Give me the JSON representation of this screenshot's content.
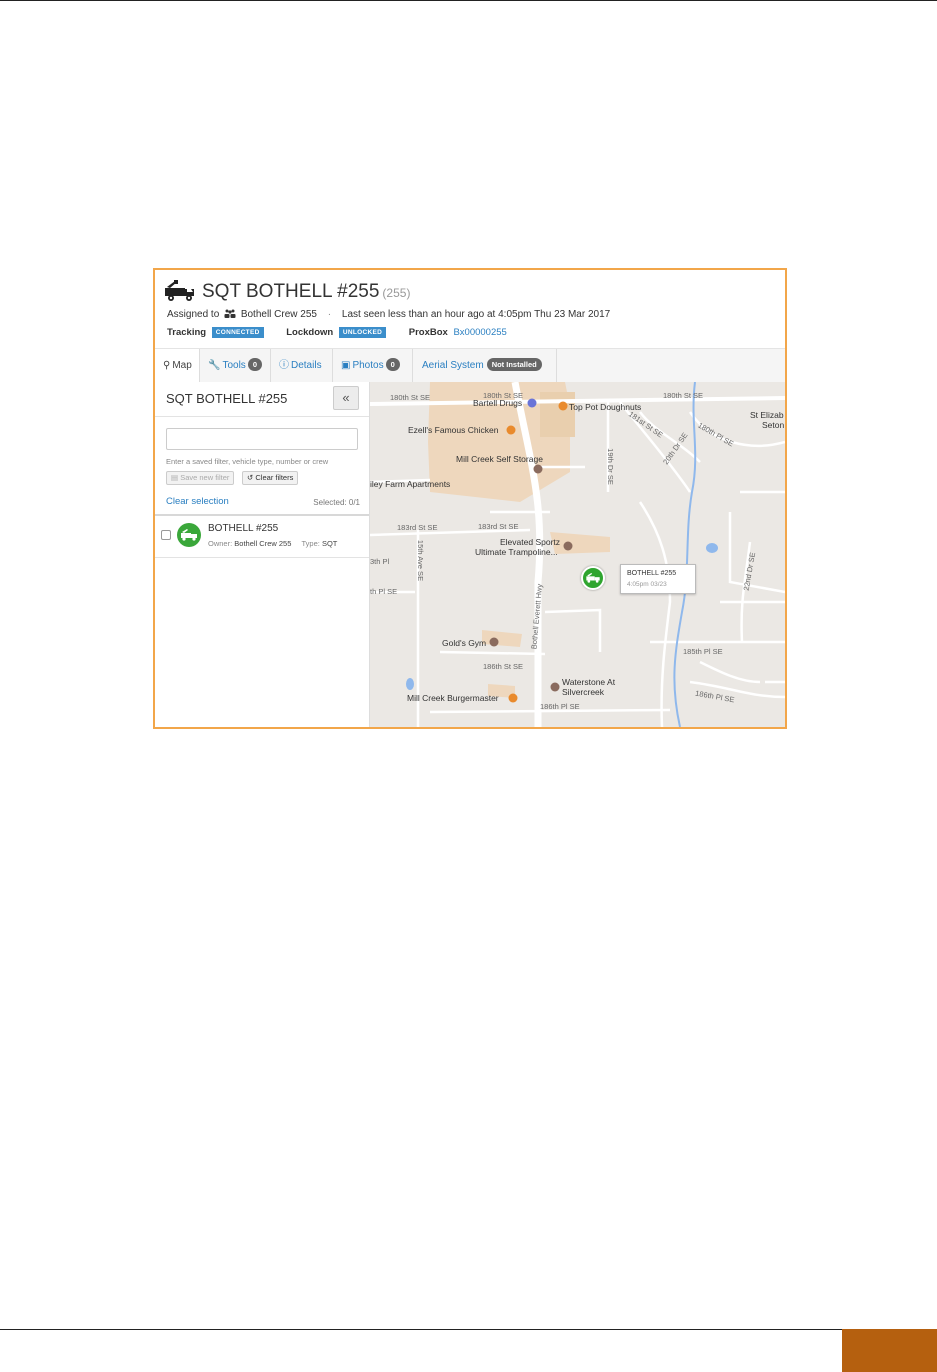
{
  "header": {
    "title": "SQT BOTHELL #255",
    "vehicle_number": "(255)",
    "assigned_label": "Assigned to",
    "crew_name": "Bothell Crew 255",
    "separator": "·",
    "last_seen": "Last seen less than an hour ago at 4:05pm Thu 23 Mar 2017",
    "tracking_label": "Tracking",
    "tracking_status": "CONNECTED",
    "lockdown_label": "Lockdown",
    "lockdown_status": "UNLOCKED",
    "proxbox_label": "ProxBox",
    "proxbox_id": "Bx00000255",
    "status_color": "#3b8ecb"
  },
  "tabs": [
    {
      "label": "Map",
      "icon": "map-marker-icon",
      "active": true
    },
    {
      "label": "Tools",
      "icon": "wrench-icon",
      "count": "0"
    },
    {
      "label": "Details",
      "icon": "info-icon"
    },
    {
      "label": "Photos",
      "icon": "image-icon",
      "count": "0"
    },
    {
      "label": "Aerial System",
      "badge": "Not Installed"
    }
  ],
  "sidebar": {
    "title": "SQT BOTHELL #255",
    "collapse_glyph": "«",
    "filter_value": "",
    "filter_help": "Enter a saved filter, vehicle type, number or crew",
    "save_filter_label": "Save new filter",
    "clear_filters_label": "Clear filters",
    "clear_selection_label": "Clear selection",
    "selected_count": "Selected: 0/1",
    "vehicles": [
      {
        "name": "BOTHELL #255",
        "owner_label": "Owner:",
        "owner": "Bothell Crew 255",
        "type_label": "Type:",
        "type": "SQT",
        "status_color": "#3aa73a"
      }
    ]
  },
  "map": {
    "pois": [
      "Bartell Drugs",
      "Top Pot Doughnuts",
      "Ezell's Famous Chicken",
      "Mill Creek Self Storage",
      "iley Farm Apartments",
      "Elevated Sportz",
      "Ultimate Trampoline...",
      "Gold's Gym",
      "Waterstone At",
      "Silvercreek",
      "Mill Creek Burgermaster",
      "St Elizab",
      "Seton"
    ],
    "streets": [
      "180th St SE",
      "180th St SE",
      "180th St SE",
      "181st St SE",
      "20th Dr SE",
      "180th Pl SE",
      "19th Dr SE",
      "183rd St SE",
      "183rd St SE",
      "15th Ave SE",
      "Bothell Everett Hwy",
      "22nd Dr SE",
      "185th Pl SE",
      "186th St SE",
      "186th Pl SE",
      "186th Pl SE",
      "3th Pl",
      "th Pl SE"
    ],
    "marker_popup": {
      "title": "BOTHELL #255",
      "time": "4:05pm 03/23"
    },
    "marker_color": "#2fa52f",
    "poi_food_color": "#e98a2c",
    "poi_shop_color": "#6a74d8",
    "poi_place_color": "#8a6b5e",
    "water_color": "#8fb8ec"
  }
}
